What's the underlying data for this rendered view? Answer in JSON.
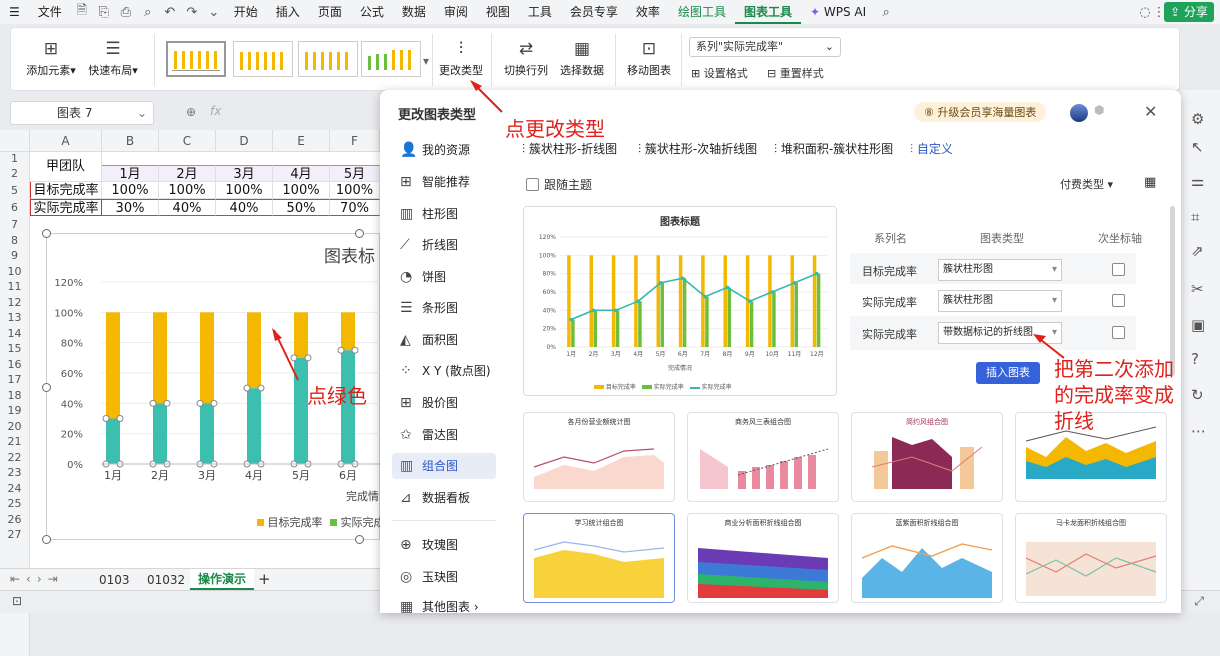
{
  "menubar": {
    "file": "文件",
    "items": [
      "开始",
      "插入",
      "页面",
      "公式",
      "数据",
      "审阅",
      "视图",
      "工具",
      "会员专享",
      "效率"
    ],
    "drawing_tools": "绘图工具",
    "chart_tools": "图表工具",
    "wps_ai": "WPS AI",
    "share": "分享"
  },
  "ribbon": {
    "add_element": "添加元素",
    "quick_layout": "快速布局",
    "change_type": "更改类型",
    "switch_row_col": "切换行列",
    "select_data": "选择数据",
    "move_chart": "移动图表",
    "series_select": "系列\"实际完成率\"",
    "set_format": "设置格式",
    "reset_style": "重置样式"
  },
  "formula": {
    "name_box": "图表 7",
    "fx": "fx"
  },
  "sheet": {
    "columns": [
      "A",
      "B",
      "C",
      "D",
      "E",
      "F"
    ],
    "rows": [
      "1",
      "2",
      "5",
      "6",
      "7",
      "8",
      "9",
      "10",
      "11",
      "12",
      "13",
      "14",
      "15",
      "16",
      "17",
      "18",
      "19",
      "20",
      "21",
      "22",
      "23",
      "24",
      "25",
      "26",
      "27"
    ],
    "team": "甲团队",
    "months": [
      "1月",
      "2月",
      "3月",
      "4月",
      "5月"
    ],
    "row_target_label": "目标完成率",
    "row_target": [
      "100%",
      "100%",
      "100%",
      "100%",
      "100%"
    ],
    "row_actual_label": "实际完成率",
    "row_actual": [
      "30%",
      "40%",
      "40%",
      "50%",
      "70%"
    ]
  },
  "chart": {
    "title": "图表标",
    "yticks": [
      "120%",
      "100%",
      "80%",
      "60%",
      "40%",
      "20%",
      "0%"
    ],
    "xticks": [
      "1月",
      "2月",
      "3月",
      "4月",
      "5月",
      "6月"
    ],
    "xlabel": "完成情",
    "legend_target": "目标完成率",
    "legend_actual": "实际完成"
  },
  "chart_data": {
    "type": "bar",
    "categories": [
      "1月",
      "2月",
      "3月",
      "4月",
      "5月",
      "6月"
    ],
    "series": [
      {
        "name": "目标完成率",
        "values": [
          100,
          100,
          100,
          100,
          100,
          100
        ]
      },
      {
        "name": "实际完成率",
        "values": [
          30,
          40,
          40,
          50,
          70,
          75
        ]
      }
    ],
    "ylim": [
      0,
      120
    ]
  },
  "tabs": {
    "sheet1": "0103",
    "sheet2": "01032",
    "sheet3": "操作演示"
  },
  "dialog": {
    "title": "更改图表类型",
    "vip": "升级会员享海量图表",
    "sidebar": [
      "我的资源",
      "智能推荐",
      "柱形图",
      "折线图",
      "饼图",
      "条形图",
      "面积图",
      "X Y (散点图)",
      "股价图",
      "雷达图",
      "组合图",
      "数据看板",
      "玫瑰图",
      "玉玦图",
      "其他图表"
    ],
    "top_types": [
      "簇状柱形-折线图",
      "簇状柱形-次轴折线图",
      "堆积面积-簇状柱形图",
      "自定义"
    ],
    "follow_theme": "跟随主题",
    "paid_type": "付费类型",
    "preview_title": "图表标题",
    "preview_yticks": [
      "120%",
      "100%",
      "80%",
      "60%",
      "40%",
      "20%",
      "0%"
    ],
    "preview_xticks": [
      "1月",
      "2月",
      "3月",
      "4月",
      "5月",
      "6月",
      "7月",
      "8月",
      "9月",
      "10月",
      "11月",
      "12月"
    ],
    "preview_xlabel": "完成情况",
    "preview_legend": [
      "目标完成率",
      "实际完成率",
      "实际完成率"
    ],
    "table_headers": [
      "系列名",
      "图表类型",
      "次坐标轴"
    ],
    "rows": [
      {
        "name": "目标完成率",
        "type": "簇状柱形图"
      },
      {
        "name": "实际完成率",
        "type": "簇状柱形图"
      },
      {
        "name": "实际完成率",
        "type": "带数据标记的折线图"
      }
    ],
    "insert": "插入图表",
    "gallery": [
      "各月份营业额统计图",
      "商务风三表组合图",
      "简约风组合图",
      "",
      "学习统计组合图",
      "商业分析面积折线组合图",
      "蓝紫面积折线组合图",
      "马卡龙面积折线组合图"
    ]
  },
  "annotations": {
    "a1": "点更改类型",
    "a2": "点绿色",
    "a3_l1": "把第二次添加",
    "a3_l2": "的完成率变成",
    "a3_l3": "折线"
  },
  "colors": {
    "target": "#f5b800",
    "actual_bar": "#3dbfb0",
    "green_bar": "#6cbf3d",
    "line": "#36b9b0",
    "accent": "#2a55c5",
    "brand": "#1fa35b",
    "annot": "#e0211b"
  }
}
